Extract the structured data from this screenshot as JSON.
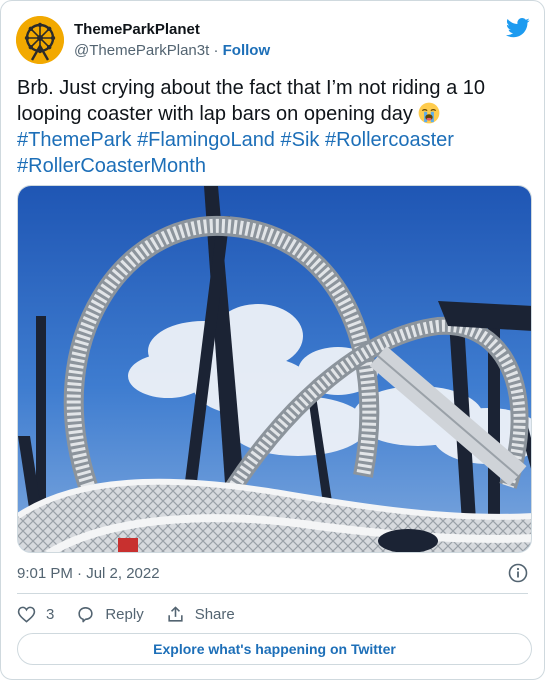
{
  "author": {
    "display_name": "ThemeParkPlanet",
    "handle": "@ThemeParkPlan3t",
    "separator": " · ",
    "follow_label": "Follow",
    "avatar_icon": "ferris-wheel-logo"
  },
  "tweet": {
    "text": "Brb. Just crying about the fact that I’m not riding a 10 looping coaster with lap bars on opening day",
    "emoji": "loudly-crying-face",
    "hashtags": [
      "#ThemePark",
      "#FlamingoLand",
      "#Sik",
      "#Rollercoaster",
      "#RollerCoasterMonth"
    ],
    "timestamp": "9:01 PM · Jul 2, 2022"
  },
  "actions": {
    "like_count": "3",
    "reply_label": "Reply",
    "share_label": "Share"
  },
  "footer": {
    "explore_label": "Explore what's happening on Twitter"
  },
  "colors": {
    "brand_blue": "#1d9bf0",
    "link_blue": "#1d6fb8",
    "avatar_yellow": "#f2a900",
    "secondary_text": "#536471"
  }
}
